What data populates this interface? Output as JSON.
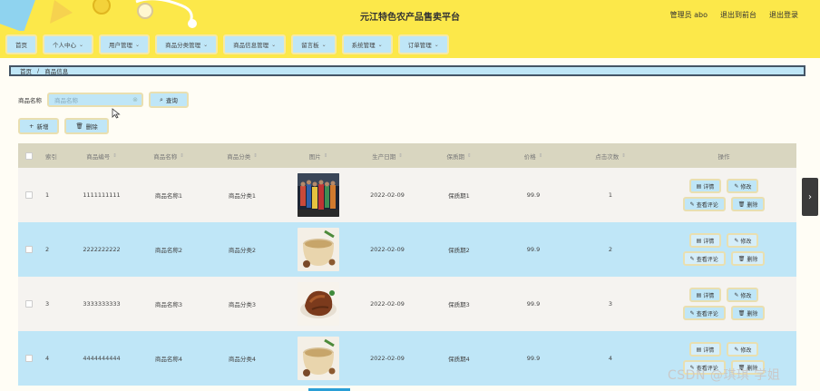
{
  "header": {
    "title": "元江特色农产品售卖平台",
    "user_label": "管理员 abo",
    "back_front_label": "退出到前台",
    "logout_label": "退出登录"
  },
  "nav": {
    "items": [
      {
        "label": "首页",
        "has_caret": false
      },
      {
        "label": "个人中心",
        "has_caret": true
      },
      {
        "label": "用户管理",
        "has_caret": true
      },
      {
        "label": "商品分类管理",
        "has_caret": true
      },
      {
        "label": "商品信息管理",
        "has_caret": true
      },
      {
        "label": "留言板",
        "has_caret": true
      },
      {
        "label": "系统管理",
        "has_caret": true
      },
      {
        "label": "订单管理",
        "has_caret": true
      }
    ]
  },
  "breadcrumb": {
    "home": "首页",
    "sep": "/",
    "current": "商品信息"
  },
  "search": {
    "label": "商品名称",
    "placeholder": "商品名称",
    "button_label": "查询"
  },
  "toolbar": {
    "add_label": "新增",
    "delete_label": "删除"
  },
  "table": {
    "headers": [
      "索引",
      "商品编号",
      "商品名称",
      "商品分类",
      "图片",
      "生产日期",
      "保质期",
      "价格",
      "点击次数",
      "操作"
    ],
    "rows": [
      {
        "index": "1",
        "code": "1111111111",
        "name": "商品名称1",
        "category": "商品分类1",
        "date": "2022-02-09",
        "shelf": "保质期1",
        "price": "99.9",
        "clicks": "1",
        "image": "people-photo"
      },
      {
        "index": "2",
        "code": "2222222222",
        "name": "商品名称2",
        "category": "商品分类2",
        "date": "2022-02-09",
        "shelf": "保质期2",
        "price": "99.9",
        "clicks": "2",
        "image": "grain-bowl-photo"
      },
      {
        "index": "3",
        "code": "3333333333",
        "name": "商品名称3",
        "category": "商品分类3",
        "date": "2022-02-09",
        "shelf": "保质期3",
        "price": "99.9",
        "clicks": "3",
        "image": "roast-meat-photo"
      },
      {
        "index": "4",
        "code": "4444444444",
        "name": "商品名称4",
        "category": "商品分类4",
        "date": "2022-02-09",
        "shelf": "保质期4",
        "price": "99.9",
        "clicks": "4",
        "image": "grain-bowl-photo"
      }
    ],
    "actions": {
      "detail": "详情",
      "edit": "修改",
      "review": "查看评论",
      "delete": "删除"
    }
  },
  "watermark": "CSDN @琪琪 学姐",
  "colors": {
    "header_bg": "#fce84a",
    "accent_blue": "#bfe6f7",
    "table_header": "#d9d6c0"
  }
}
